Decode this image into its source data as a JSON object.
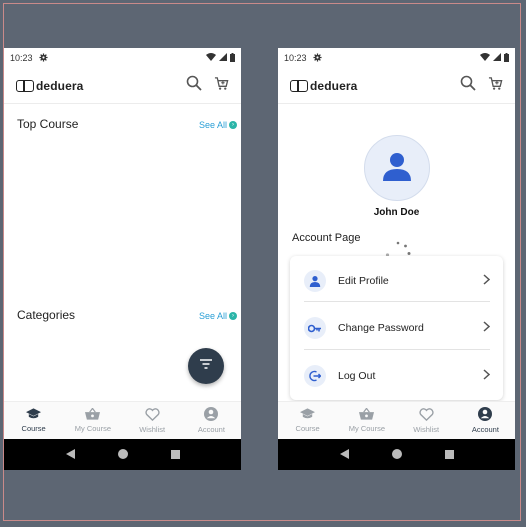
{
  "status": {
    "time": "10:23"
  },
  "brand": {
    "name": "deduera"
  },
  "colors": {
    "accent": "#2f3d4c",
    "link": "#2a9fd6",
    "icon_blue": "#2f5fcf"
  },
  "course_page": {
    "sections": [
      {
        "title": "Top Course",
        "see_all": "See All"
      },
      {
        "title": "Categories",
        "see_all": "See All"
      }
    ],
    "fab_icon": "filter-icon"
  },
  "nav": {
    "items": [
      {
        "label": "Course",
        "icon": "graduation-cap-icon"
      },
      {
        "label": "My Course",
        "icon": "basket-icon"
      },
      {
        "label": "Wishlist",
        "icon": "heart-icon"
      },
      {
        "label": "Account",
        "icon": "account-circle-icon"
      }
    ],
    "left_active": "Course",
    "right_active": "Account"
  },
  "account_page": {
    "user_name": "John Doe",
    "title": "Account Page",
    "menu": [
      {
        "label": "Edit Profile",
        "icon": "person-icon"
      },
      {
        "label": "Change Password",
        "icon": "key-icon"
      },
      {
        "label": "Log Out",
        "icon": "logout-icon"
      }
    ]
  }
}
